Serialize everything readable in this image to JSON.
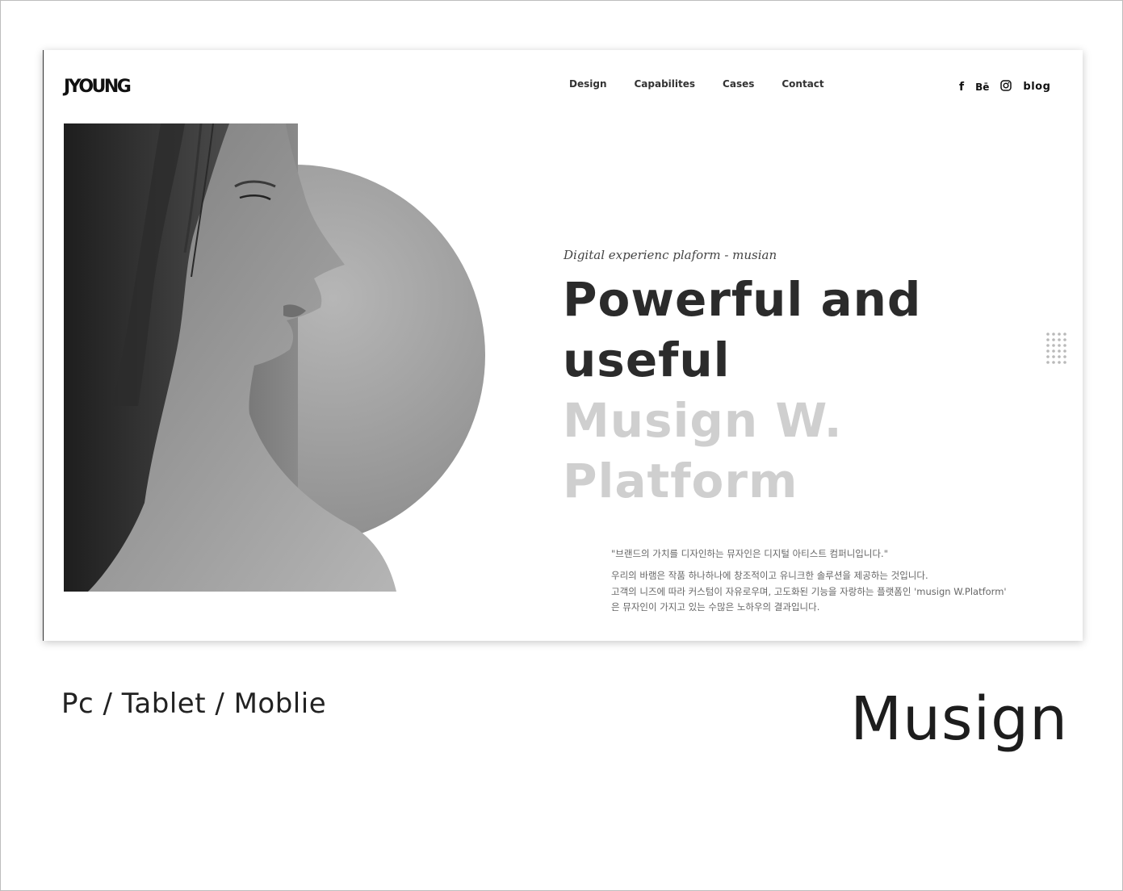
{
  "header": {
    "logo": "JYOUNG",
    "nav": [
      "Design",
      "Capabilites",
      "Cases",
      "Contact"
    ],
    "social": {
      "facebook": "f",
      "behance": "Bē",
      "blog": "blog"
    }
  },
  "hero": {
    "tagline": "Digital experienc plaform - musian",
    "headline_dark": [
      "Powerful and",
      "useful"
    ],
    "headline_light": [
      "Musign W.",
      "Platform"
    ],
    "image": "grayscale-woman-profile-portrait"
  },
  "description": {
    "quote": "\"브랜드의 가치를 디자인하는 뮤자인은 디지털 아티스트 컴퍼니입니다.\"",
    "lines": [
      "우리의 바램은 작품 하나하나에 창조적이고 유니크한 솔루션을 제공하는 것입니다.",
      "고객의 니즈에 따라 커스텀이 자유로우며, 고도화된 기능을 자랑하는 플랫폼인 'musign W.Platform'",
      "은 뮤자인이 가지고 있는 수많은 노하우의 결과입니다."
    ]
  },
  "icons": [
    "facebook-icon",
    "behance-icon",
    "instagram-icon",
    "dot-grid-icon"
  ],
  "colors": {
    "headline_dark": "#2b2b2b",
    "headline_light": "#cfcfcf",
    "text_muted": "#666666"
  },
  "captions": {
    "platforms": "Pc / Tablet / Moblie",
    "project": "Musign"
  }
}
